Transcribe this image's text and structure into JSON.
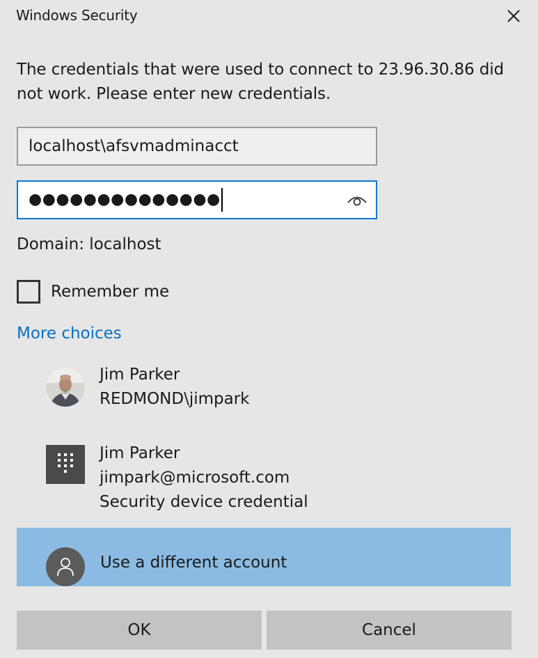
{
  "window": {
    "title": "Windows Security",
    "close_icon": "close-icon"
  },
  "message": "The credentials that were used to connect to 23.96.30.86 did not work. Please enter new credentials.",
  "username_field": {
    "value": "localhost\\afsvmadminacct"
  },
  "password_field": {
    "masked_value": "●●●●●●●●●●●●●●",
    "reveal_icon": "eye-icon"
  },
  "domain_text": "Domain: localhost",
  "remember_me": {
    "label": "Remember me",
    "checked": false
  },
  "more_choices_label": "More choices",
  "accounts": [
    {
      "name": "Jim Parker",
      "detail": "REDMOND\\jimpark",
      "icon": "user-photo-avatar"
    },
    {
      "name": "Jim Parker",
      "detail": "jimpark@microsoft.com",
      "subtext": "Security device credential",
      "icon": "keypad-icon"
    }
  ],
  "different_account": {
    "label": "Use a different account",
    "icon": "person-icon",
    "selected": true
  },
  "buttons": {
    "ok": "OK",
    "cancel": "Cancel"
  },
  "colors": {
    "accent": "#0a78d4",
    "link": "#0a6fc2",
    "selected_row": "#8bbbe2",
    "background": "#e6e6e6",
    "button": "#c3c3c3"
  }
}
